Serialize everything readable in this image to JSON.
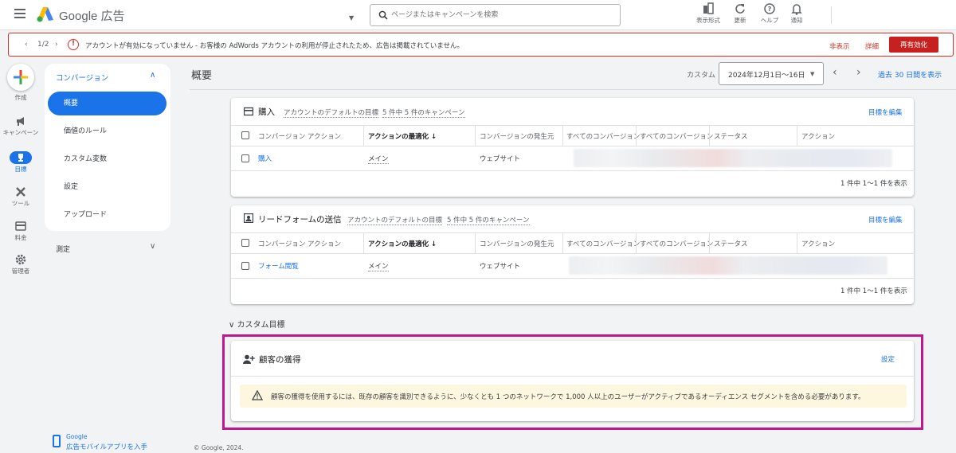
{
  "header": {
    "brand": "Google 広告",
    "search_placeholder": "ページまたはキャンペーンを検索",
    "tools": [
      {
        "label": "表示形式",
        "icon": "display-format-icon"
      },
      {
        "label": "更新",
        "icon": "refresh-icon"
      },
      {
        "label": "ヘルプ",
        "icon": "help-icon"
      },
      {
        "label": "通知",
        "icon": "bell-icon"
      }
    ]
  },
  "alert": {
    "pager": "1/2",
    "message": "アカウントが有効になっていません - お客様の AdWords アカウントの利用が停止されたため、広告は掲載されていません。",
    "hide": "非表示",
    "details": "詳細",
    "reactivate": "再有効化"
  },
  "rail": {
    "create": "作成",
    "campaigns": "キャンペーン",
    "goals": "目標",
    "tools": "ツール",
    "billing": "料金",
    "admin": "管理者"
  },
  "subnav": {
    "header": "コンバージョン",
    "items": [
      "概要",
      "価値のルール",
      "カスタム変数",
      "設定",
      "アップロード"
    ],
    "measure": "測定",
    "mobile_line1": "Google",
    "mobile_line2": "広告モバイルアプリを入手"
  },
  "main": {
    "title": "概要",
    "date_label": "カスタム",
    "date_value": "2024年12月1日〜16日",
    "last30": "過去 30 日間を表示",
    "columns": [
      "コンバージョン アクション",
      "アクションの最適化",
      "コンバージョンの発生元",
      "すべてのコンバージョン",
      "すべてのコンバージョン",
      "ステータス",
      "アクション"
    ],
    "purchase": {
      "title": "購入",
      "default_goal": "アカウントのデフォルトの目標",
      "campaign_count": "5 件中 5 件のキャンペーン",
      "edit_goal": "目標を編集",
      "row": {
        "name": "購入",
        "optimization": "メイン",
        "source": "ウェブサイト"
      },
      "pager": "1 件中 1〜1 件を表示"
    },
    "lead_form": {
      "title": "リードフォームの送信",
      "default_goal": "アカウントのデフォルトの目標",
      "campaign_count": "5 件中 5 件のキャンペーン",
      "edit_goal": "目標を編集",
      "row": {
        "name": "フォーム閲覧",
        "optimization": "メイン",
        "source": "ウェブサイト"
      },
      "pager": "1 件中 1〜1 件を表示"
    },
    "custom_goals": "カスタム目標",
    "acquisition": {
      "title": "顧客の獲得",
      "settings": "設定",
      "warning": "顧客の獲得を使用するには、既存の顧客を識別できるように、少なくとも 1 つのネットワークで 1,000 人以上のユーザーがアクティブであるオーディエンス セグメントを含める必要があります。"
    }
  },
  "footer": "© Google, 2024.",
  "colors": {
    "accent": "#1a73e8",
    "alert": "#d93025",
    "highlight": "#c2188f",
    "warning_bg": "#fef7e0"
  }
}
